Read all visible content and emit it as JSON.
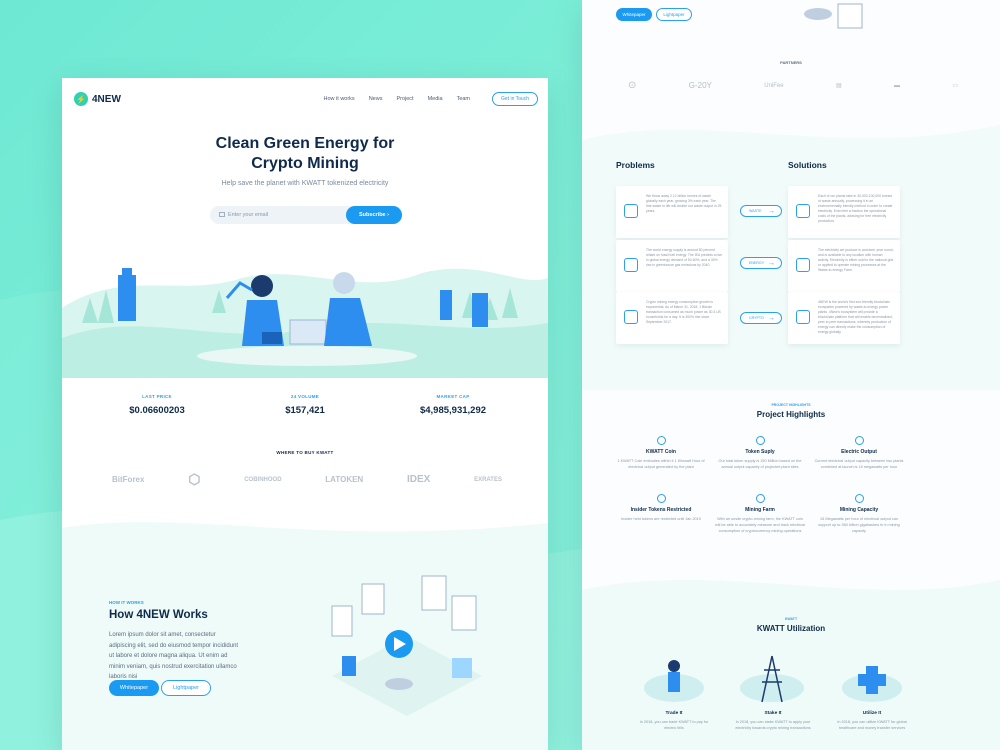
{
  "colors": {
    "accent": "#1a9af0",
    "mint": "#6ee8d3",
    "navy": "#0f2a4a"
  },
  "nav": {
    "logo": "4NEW",
    "links": [
      "How it works",
      "News",
      "Project",
      "Media",
      "Team"
    ],
    "cta": "Get in Touch"
  },
  "hero": {
    "title_l1": "Clean Green Energy for",
    "title_l2": "Crypto Mining",
    "subtitle": "Help save the planet with KWATT tokenized electricity",
    "email_placeholder": "Enter your email",
    "subscribe": "Subscribe"
  },
  "stats": [
    {
      "label": "LAST PRICE",
      "value": "$0.06600203"
    },
    {
      "label": "24 VOLUME",
      "value": "$157,421"
    },
    {
      "label": "MARKET CAP",
      "value": "$4,985,931,292"
    }
  ],
  "where": {
    "label": "WHERE TO BUY KWATT",
    "exchanges": [
      "BitForex",
      "",
      "COBINHOOD",
      "LATOKEN",
      "IDEX",
      "EXRATES"
    ]
  },
  "how": {
    "kicker": "HOW IT WORKS",
    "title": "How 4NEW Works",
    "body": "Lorem ipsum dolor sit amet, consectetur adipiscing elit, sed do eiusmod tempor incididunt ut labore et dolore magna aliqua. Ut enim ad minim veniam, quis nostrud exercitation ullamco laboris nisi",
    "whitepaper": "Whitepaper",
    "lightpaper": "Lightpaper"
  },
  "right": {
    "whitepaper": "Whitepaper",
    "lightpaper": "Lightpaper",
    "partners_label": "PARTNERS",
    "partners": [
      "",
      "G-20Y",
      "UniFee",
      "",
      "",
      ""
    ],
    "problems": "Problems",
    "solutions": "Solutions",
    "problem_texts": [
      "We throw away 2.12 billion tonnes of waste globally each year, growing 3% each year. The first waste to life will double our waste output in 25 years.",
      "The world energy supply is around 80 percent reliant on fossil fuel energy. The IEA predicts a rise in global energy demand of 50-60%, and a 30% rise in greenhouse gas emissions by 2040.",
      "Crypto mining energy consumption growth is exponential. As of March 31, 2018, 1 Bitcoin transaction consumed as much power as 30.3 US households for a day. It is 300% rise since September 2017."
    ],
    "pills": [
      "WASTE",
      "ENERGY",
      "CRYPTO"
    ],
    "solution_texts": [
      "Each of our plants take in 30,000-100,000 tonnes of waste annually, processing it in an environmentally friendly method in order to create electricity. Even feel a fraction the operational costs of the plants, allowing for free electricity production.",
      "The electricity we produce is constant, year round, and is available to any location with human activity. Electricity is either sold to the national grid or applied to operate mining processes at the Waste-to-energy Farm.",
      "4NEW is the world's first eco-friendly blockchain ecosystem powered by waste-to-energy power plants. 4New's ecosystem will provide a blockchain platform that will enable decentralized, peer to peer transactions, whereby production of energy can directly make the consumption of energy globally."
    ],
    "highlights_kicker": "PROJECT HIGHLIGHTS",
    "highlights_title": "Project Highlights",
    "highlights": [
      {
        "t": "KWATT Coin",
        "d": "1 KWATT Coin embodies within it 1 Kilowatt Hour of electrical output generated by the plant"
      },
      {
        "t": "Token Suply",
        "d": "Our total token supply is 150 Million based on the annual output capacity of projected plant sites"
      },
      {
        "t": "Electric Output",
        "d": "Current electrical output capacity between two plants combined at launch is 15 megawatts per hour"
      },
      {
        "t": "Insider Tokens Restricted",
        "d": "Insider held tokens are restricted until Jan 2019"
      },
      {
        "t": "Mining Farm",
        "d": "With an onsite crypto-mining farm, the KWATT coin will be able to accurately measure and track electrical consumption of cryptocurrency mining operations"
      },
      {
        "t": "Mining Capacity",
        "d": "15 Megawatts per hour of electrical output can support up to 360 billion gigahashes hr in mining capacity"
      }
    ],
    "util_kicker": "KWATT",
    "util_title": "KWATT Utilization",
    "util": [
      {
        "t": "Trade It",
        "d": "In 2018, you can trade KWATT to pay for electric bills"
      },
      {
        "t": "Stake It",
        "d": "In 2018, you can stake KWATT to apply your electricity towards crypto mining transactions"
      },
      {
        "t": "Utilize It",
        "d": "In 2018, you can utilize KWATT for global healthcare and money transfer services"
      }
    ]
  }
}
